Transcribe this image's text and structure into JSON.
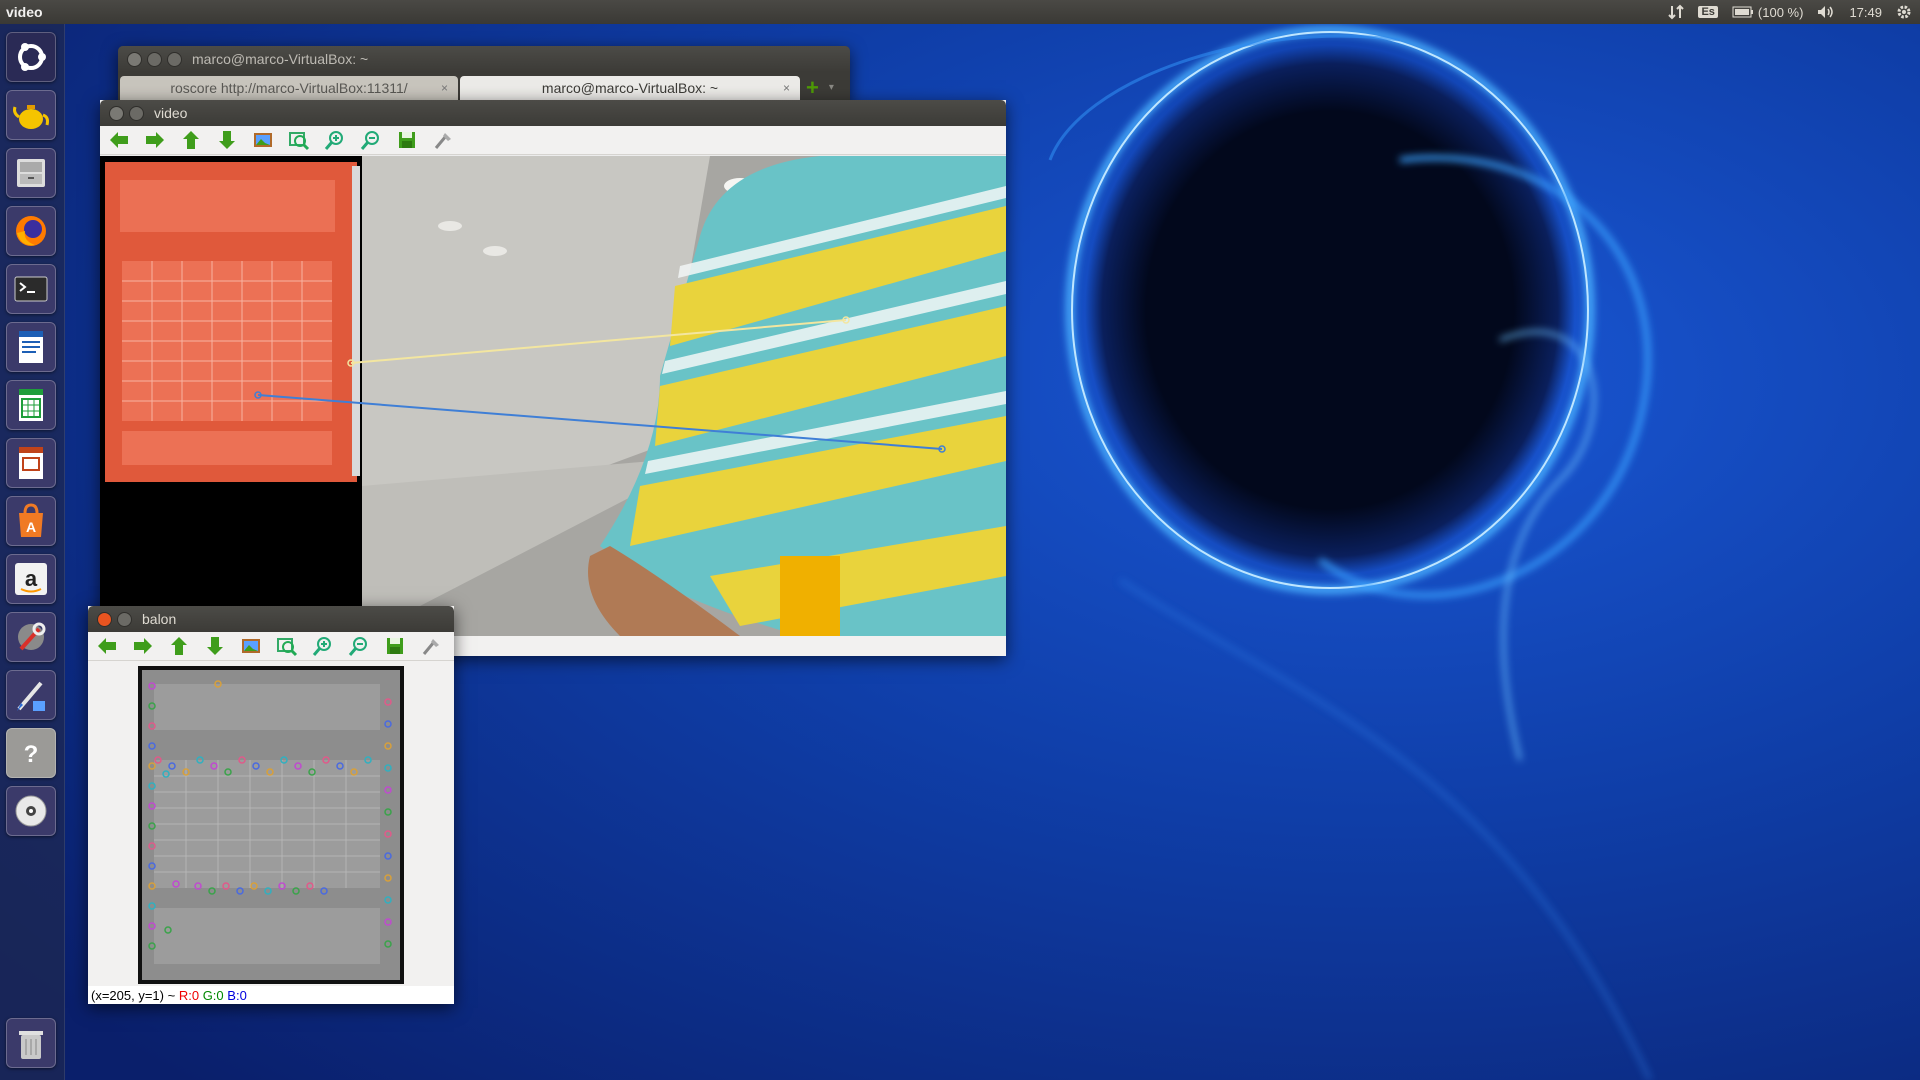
{
  "top_panel": {
    "app_name": "video",
    "keyboard_layout": "Es",
    "battery": "(100 %)",
    "clock": "17:49",
    "icons": [
      "network-icon",
      "battery-icon",
      "volume-icon",
      "settings-gear-icon"
    ]
  },
  "launcher": {
    "items": [
      {
        "name": "dash-home",
        "icon": "ubuntu-logo-icon"
      },
      {
        "name": "teapot-app",
        "icon": "teapot-icon"
      },
      {
        "name": "files",
        "icon": "file-cabinet-icon"
      },
      {
        "name": "firefox",
        "icon": "firefox-icon"
      },
      {
        "name": "terminal",
        "icon": "terminal-icon"
      },
      {
        "name": "libreoffice-writer",
        "icon": "writer-icon"
      },
      {
        "name": "libreoffice-calc",
        "icon": "calc-icon"
      },
      {
        "name": "libreoffice-impress",
        "icon": "impress-icon"
      },
      {
        "name": "software-center",
        "icon": "shopping-bag-icon"
      },
      {
        "name": "amazon",
        "icon": "amazon-icon"
      },
      {
        "name": "system-settings",
        "icon": "wrench-icon"
      },
      {
        "name": "drawing-app",
        "icon": "paint-brush-icon"
      },
      {
        "name": "help",
        "icon": "question-icon"
      },
      {
        "name": "dvd",
        "icon": "disc-icon"
      },
      {
        "name": "trash",
        "icon": "trash-icon"
      }
    ]
  },
  "terminal_window": {
    "title": "marco@marco-VirtualBox: ~",
    "tabs": [
      {
        "label": "roscore http://marco-VirtualBox:11311/",
        "active": false
      },
      {
        "label": "marco@marco-VirtualBox: ~",
        "active": true
      }
    ],
    "tab_close": "×",
    "add_tab": "+",
    "tab_menu": "▾"
  },
  "video_window": {
    "title": "video",
    "toolbar": [
      "back-arrow-icon",
      "forward-arrow-icon",
      "up-arrow-icon",
      "down-arrow-icon",
      "image-icon",
      "zoom-fit-icon",
      "zoom-in-icon",
      "zoom-out-icon",
      "save-icon",
      "properties-icon"
    ]
  },
  "balon_window": {
    "title": "balon",
    "status": {
      "coords": "(x=205, y=1) ~",
      "r": "R:0",
      "g": "G:0",
      "b": "B:0"
    }
  },
  "colors": {
    "accent_close": "#e95420",
    "panel": "#3c3b37",
    "toolbar_green": "#3f9d1b"
  }
}
